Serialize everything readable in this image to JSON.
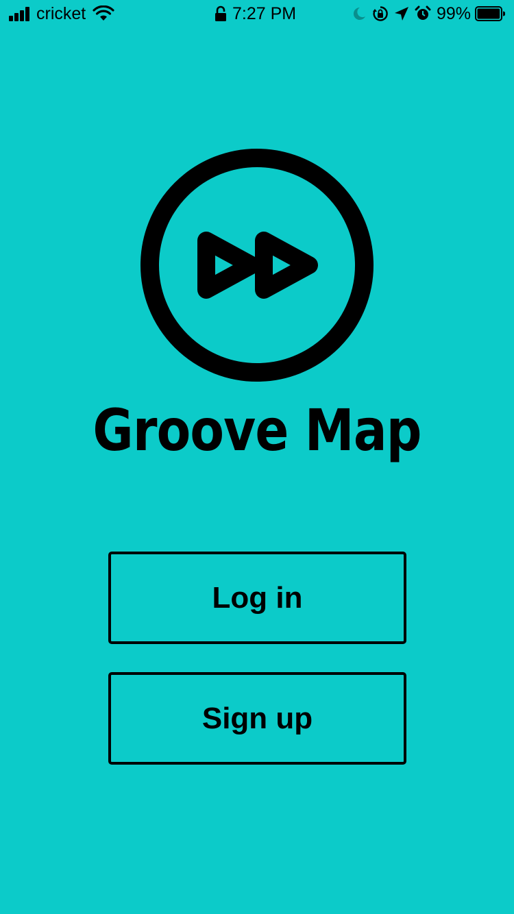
{
  "status_bar": {
    "carrier": "cricket",
    "time": "7:27 PM",
    "battery_percent": "99%",
    "battery_level": 0.99,
    "icons": [
      "signal-icon",
      "wifi-icon",
      "lock-icon",
      "moon-icon",
      "orientation-lock-icon",
      "location-arrow-icon",
      "alarm-icon",
      "battery-icon"
    ]
  },
  "app": {
    "title": "Groove Map",
    "logo_icon": "double-play-circle-icon"
  },
  "buttons": {
    "login_label": "Log in",
    "signup_label": "Sign up"
  },
  "colors": {
    "background": "#0ccbc9",
    "foreground": "#000000"
  }
}
